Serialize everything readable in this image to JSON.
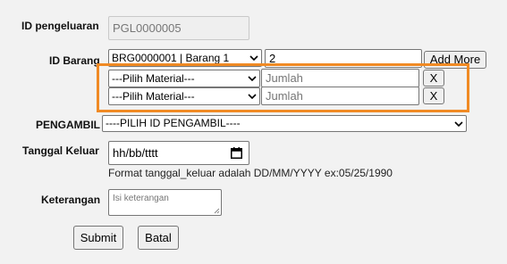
{
  "form": {
    "id_pengeluaran": {
      "label": "ID pengeluaran",
      "value": "PGL0000005"
    },
    "id_barang": {
      "label": "ID Barang",
      "selected": "BRG0000001 | Barang 1",
      "quantity_value": "2",
      "add_more_label": "Add More",
      "material_rows": [
        {
          "select_value": "---Pilih Material---",
          "jumlah_placeholder": "Jumlah",
          "remove_label": "X"
        },
        {
          "select_value": "---Pilih Material---",
          "jumlah_placeholder": "Jumlah",
          "remove_label": "X"
        }
      ]
    },
    "pengambil": {
      "label": "PENGAMBIL",
      "selected": "----PILIH ID PENGAMBIL----"
    },
    "tanggal_keluar": {
      "label": "Tanggal Keluar",
      "value": "hh/bb/tttt",
      "hint": "Format tanggal_keluar adalah DD/MM/YYYY ex:05/25/1990"
    },
    "keterangan": {
      "label": "Keterangan",
      "placeholder": "Isi keterangan"
    },
    "buttons": {
      "submit": "Submit",
      "batal": "Batal"
    }
  },
  "colors": {
    "highlight": "#f08a24",
    "background": "#f2f2f2"
  }
}
